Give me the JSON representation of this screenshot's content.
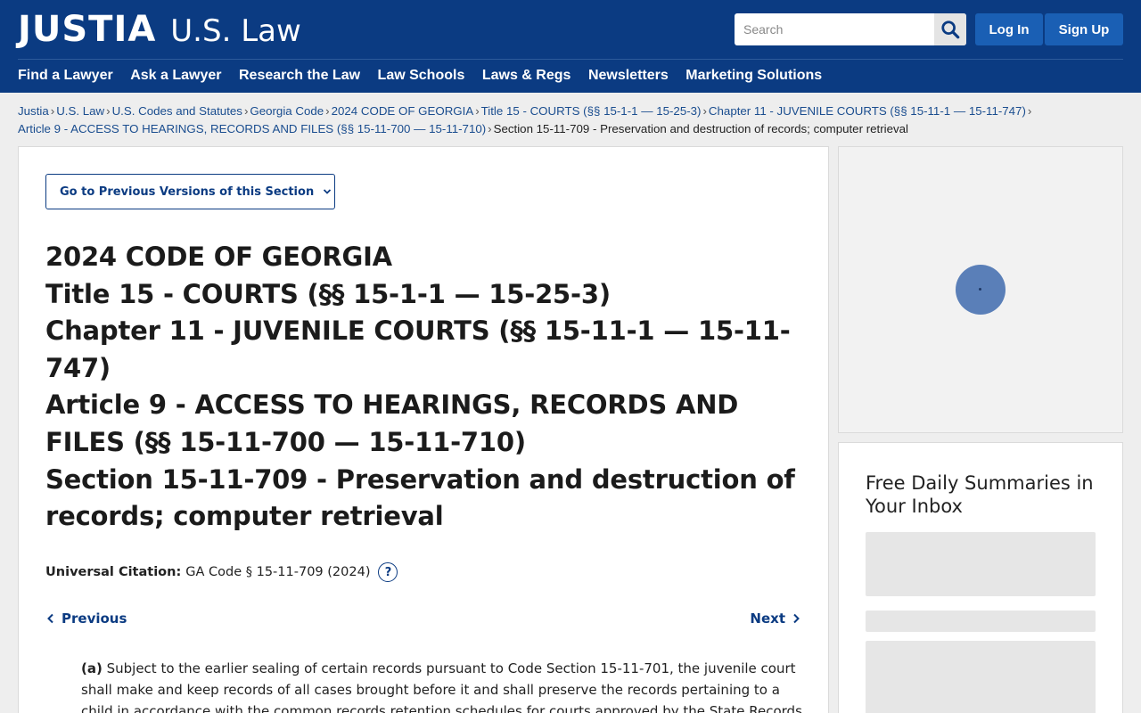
{
  "header": {
    "logo_main": "JUSTIA",
    "logo_sub": "U.S. Law",
    "search_placeholder": "Search",
    "login": "Log In",
    "signup": "Sign Up",
    "nav": [
      "Find a Lawyer",
      "Ask a Lawyer",
      "Research the Law",
      "Law Schools",
      "Laws & Regs",
      "Newsletters",
      "Marketing Solutions"
    ]
  },
  "breadcrumb": {
    "links": [
      "Justia",
      "U.S. Law",
      "U.S. Codes and Statutes",
      "Georgia Code",
      "2024 CODE OF GEORGIA",
      "Title 15 - COURTS (§§ 15-1-1 — 15-25-3)",
      "Chapter 11 - JUVENILE COURTS (§§ 15-11-1 — 15-11-747)",
      "Article 9 - ACCESS TO HEARINGS, RECORDS AND FILES (§§ 15-11-700 — 15-11-710)"
    ],
    "current": "Section 15-11-709 - Preservation and destruction of records; computer retrieval",
    "separator": "›"
  },
  "main": {
    "prev_versions": "Go to Previous Versions of this Section",
    "heading_lines": [
      "2024 CODE OF GEORGIA",
      "Title 15 - COURTS (§§ 15-1-1 — 15-25-3)",
      "Chapter 11 - JUVENILE COURTS (§§ 15-11-1 — 15-11-747)",
      "Article 9 - ACCESS TO HEARINGS, RECORDS AND FILES (§§ 15-11-700 — 15-11-710)",
      "Section 15-11-709 - Preservation and destruction of records; computer retrieval"
    ],
    "citation_label": "Universal Citation:",
    "citation_value": "GA Code § 15-11-709 (2024)",
    "help": "?",
    "previous": "Previous",
    "next": "Next",
    "para_a_label": "(a)",
    "para_a_text": " Subject to the earlier sealing of certain records pursuant to Code Section 15-11-701, the juvenile court shall make and keep records of all cases brought before it and shall preserve the records pertaining to a child in accordance with the common records retention schedules for courts approved by the State Records"
  },
  "sidebar": {
    "newsletter_title": "Free Daily Summaries in Your Inbox"
  },
  "colors": {
    "header_bg": "#0b3b82",
    "button_bg": "#1a5fb4",
    "link": "#1a4d8f"
  },
  "icons": {
    "search": "search-icon",
    "chevron_down": "chevron-down-icon",
    "chevron_left": "chevron-left-icon",
    "chevron_right": "chevron-right-icon",
    "help": "help-icon"
  }
}
